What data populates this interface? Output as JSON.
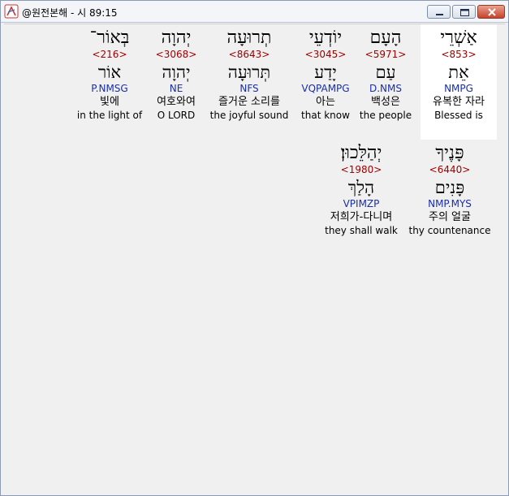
{
  "window": {
    "title": "@원전본해 - 시 89:15",
    "app_icon": "app-logo-icon",
    "controls": {
      "minimize": "minimize-icon",
      "maximize": "maximize-icon",
      "close": "close-icon"
    }
  },
  "colors": {
    "strong": "#a00000",
    "parsing": "#1a2ea8",
    "highlight": "#ffffff"
  },
  "rows": [
    {
      "words": [
        {
          "hebrew": "אַשְׁרֵי",
          "strong": "<853>",
          "lexeme": "אֵת",
          "parsing": "NMPG",
          "korean": "유복한 자라",
          "english": "Blessed is",
          "selected": true
        },
        {
          "hebrew": "הָעָם",
          "strong": "<5971>",
          "lexeme": "עַם",
          "parsing": "D.NMS",
          "korean": "백성은",
          "english": "the people",
          "selected": false
        },
        {
          "hebrew": "יוֹדְעֵי",
          "strong": "<3045>",
          "lexeme": "יָדַע",
          "parsing": "VQPAMPG",
          "korean": "아는",
          "english": "that know",
          "selected": false
        },
        {
          "hebrew": "תְרוּעָה",
          "strong": "<8643>",
          "lexeme": "תְּרוּעָה",
          "parsing": "NFS",
          "korean": "즐거운 소리를",
          "english": "the joyful sound",
          "selected": false
        },
        {
          "hebrew": "יְהוָה",
          "strong": "<3068>",
          "lexeme": "יְהוָה",
          "parsing": "NE",
          "korean": "여호와여",
          "english": "O LORD",
          "selected": false
        },
        {
          "hebrew": "בְּאוֹר־",
          "strong": "<216>",
          "lexeme": "אוֹר",
          "parsing": "P.NMSG",
          "korean": "빛에",
          "english": "in the light of",
          "selected": false
        }
      ]
    },
    {
      "words": [
        {
          "hebrew": "פָּנֶיךָ",
          "strong": "<6440>",
          "lexeme": "פָּנִים",
          "parsing": "NMP.MYS",
          "korean": "주의 얼굴",
          "english": "thy countenance",
          "selected": false
        },
        {
          "hebrew": "יְהַלֵּכוּן׃",
          "strong": "<1980>",
          "lexeme": "הָלַךְ",
          "parsing": "VPIMZP",
          "korean": "저희가-다니며",
          "english": "they shall walk",
          "selected": false
        }
      ]
    }
  ]
}
